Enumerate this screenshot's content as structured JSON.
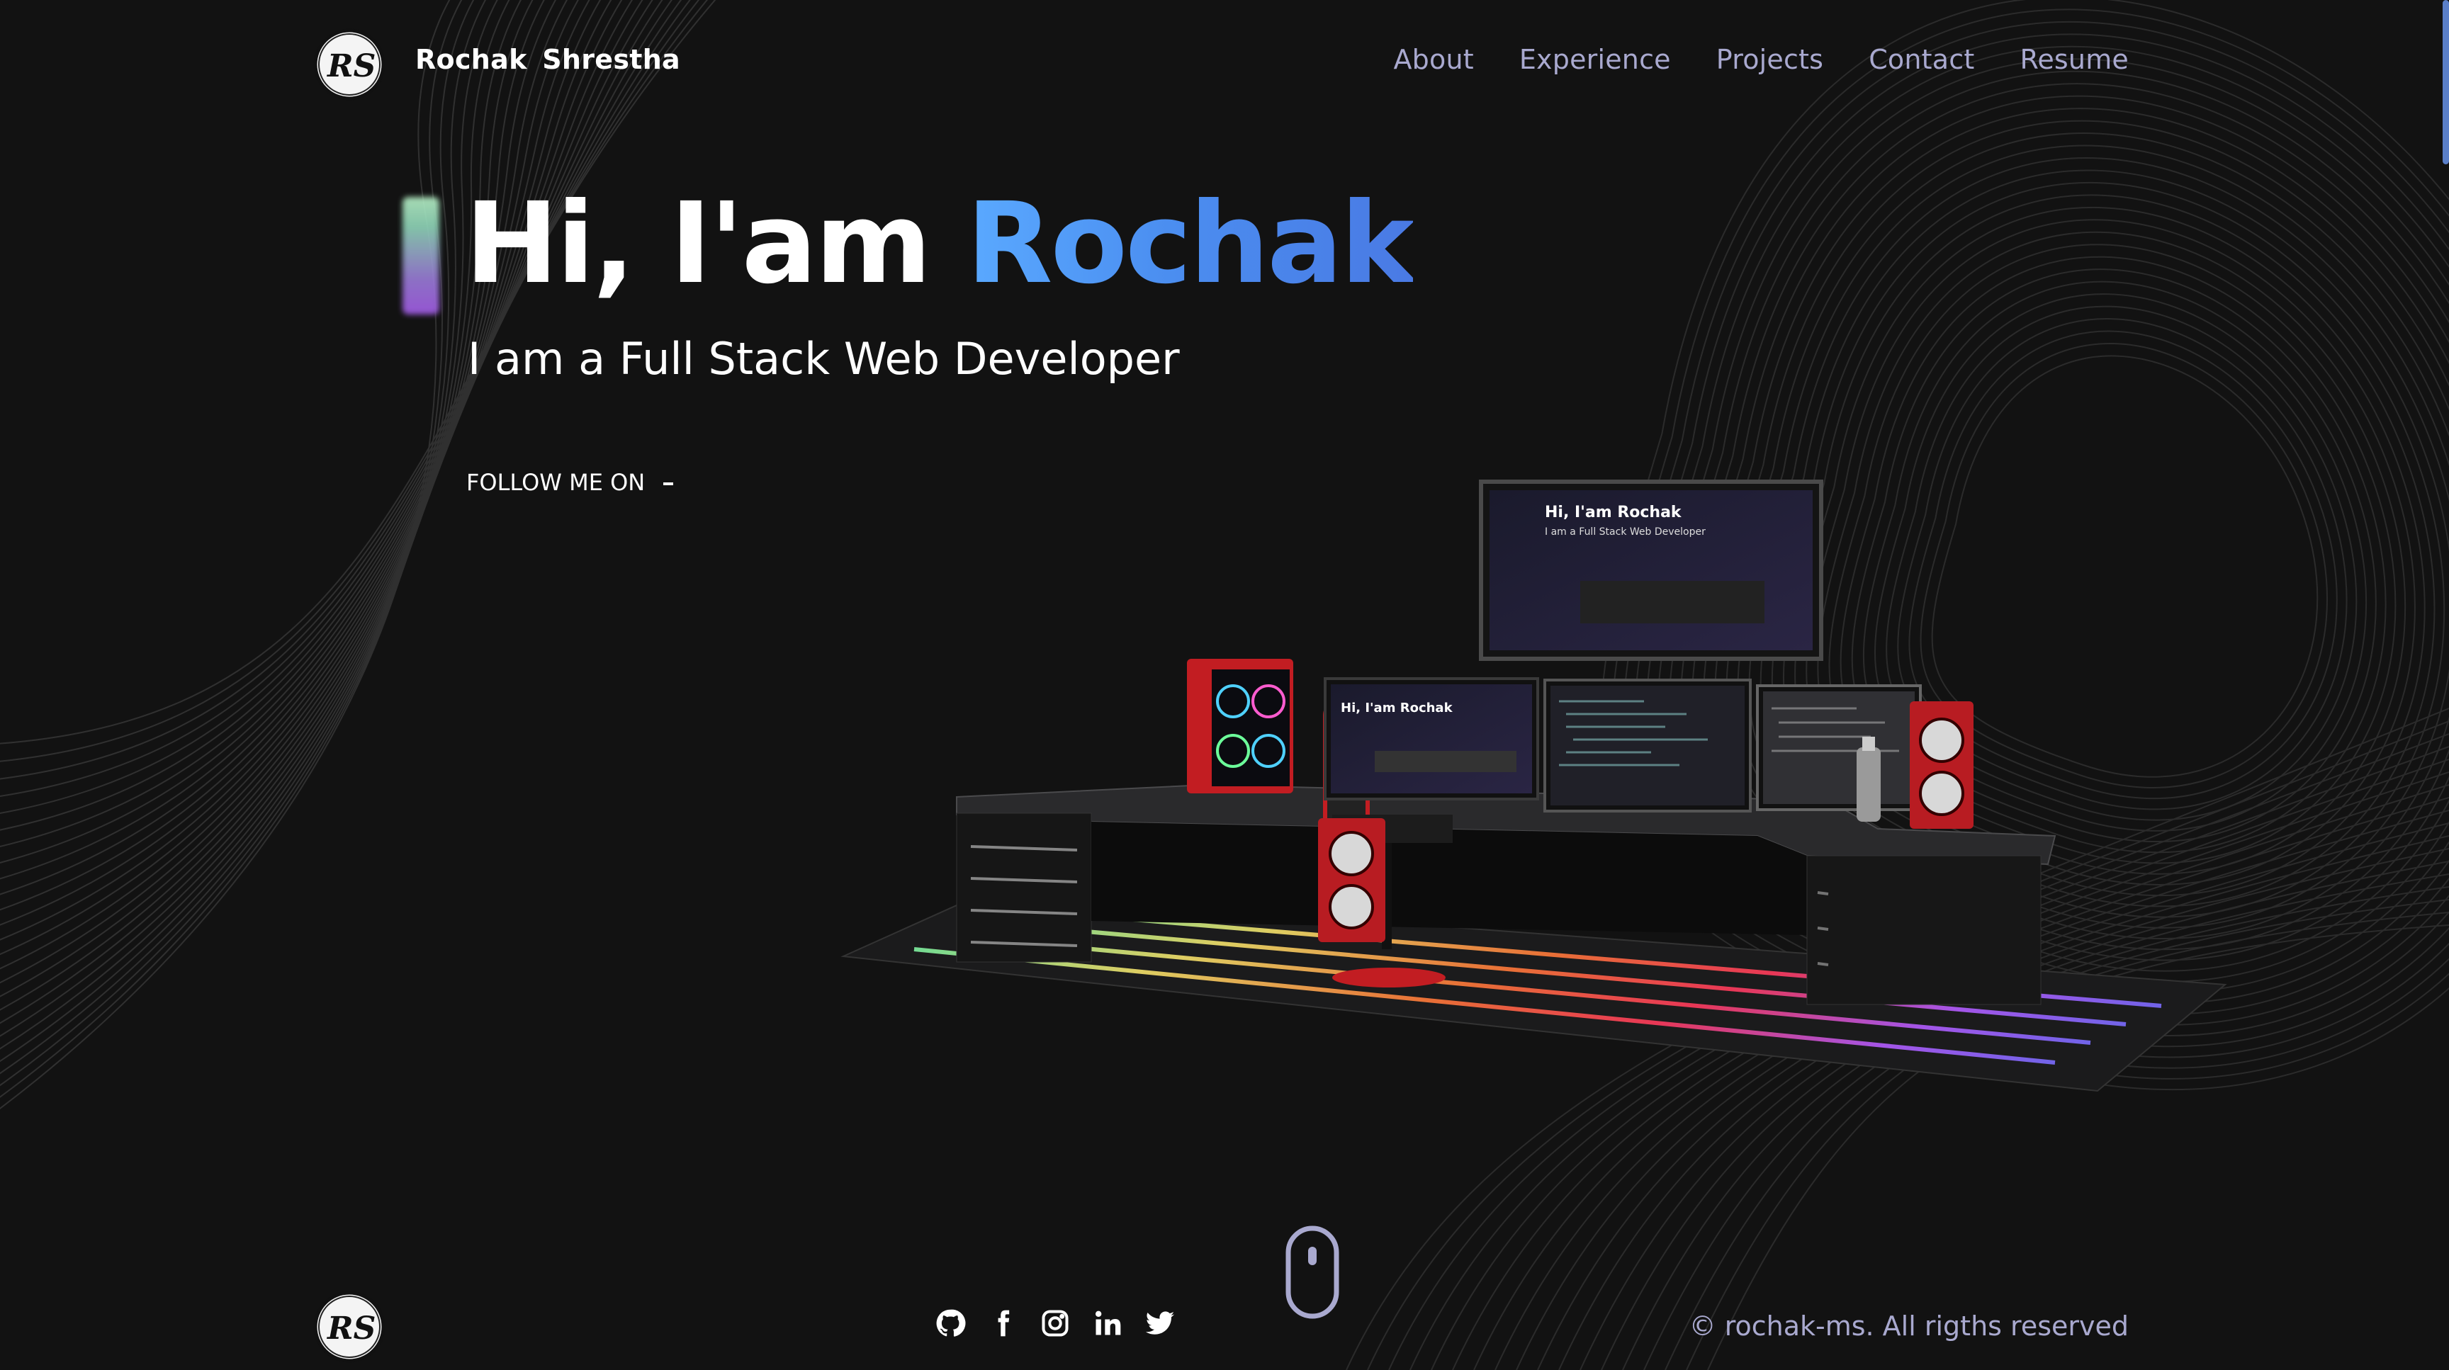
{
  "brand": {
    "logo_text": "RS",
    "name": "Rochak Shrestha"
  },
  "nav": [
    {
      "label": "About"
    },
    {
      "label": "Experience"
    },
    {
      "label": "Projects"
    },
    {
      "label": "Contact"
    },
    {
      "label": "Resume"
    }
  ],
  "hero": {
    "greeting": "Hi, I'am ",
    "name": "Rochak",
    "subtitle": "I am a Full Stack Web Developer",
    "follow_label": "FOLLOW ME ON"
  },
  "scene": {
    "monitor_title_top": "Hi, I'am Rochak",
    "monitor_sub_top": "I am a Full Stack Web Developer",
    "monitor_title_small": "Hi, I'am Rochak"
  },
  "footer": {
    "logo_text": "RS",
    "socials": [
      "github-icon",
      "facebook-icon",
      "instagram-icon",
      "linkedin-icon",
      "twitter-icon"
    ],
    "copyright": "© rochak-ms. All rigths reserved"
  },
  "colors": {
    "background": "#121212",
    "nav_text": "#a9a9cf",
    "accent_blue": "#4b8ef0",
    "logo_red": "#e0262e"
  }
}
